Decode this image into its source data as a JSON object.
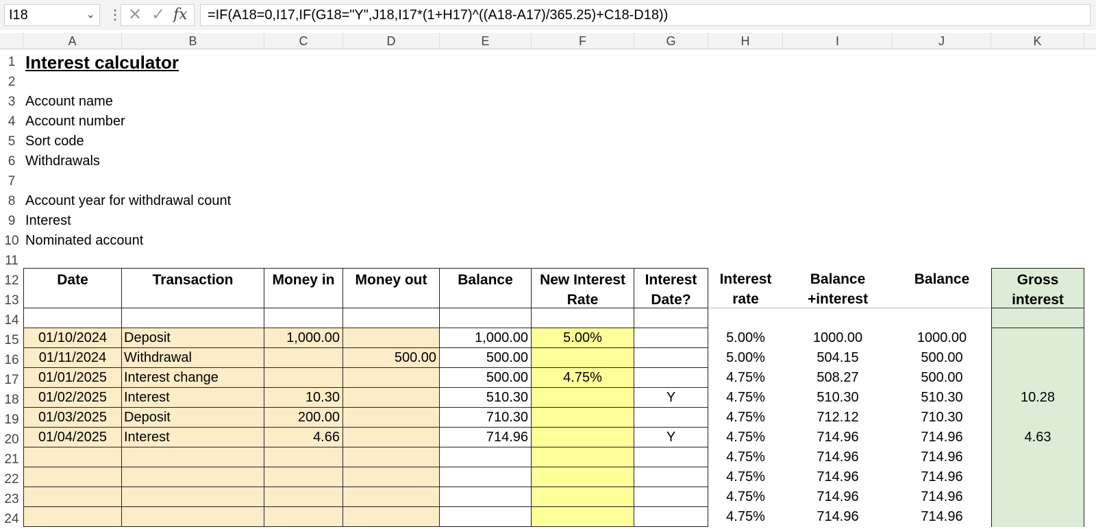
{
  "formula_bar": {
    "name_box": "I18",
    "formula": "=IF(A18=0,I17,IF(G18=\"Y\",J18,I17*(1+H17)^((A18-A17)/365.25)+C18-D18))"
  },
  "columns": [
    "A",
    "B",
    "C",
    "D",
    "E",
    "F",
    "G",
    "H",
    "I",
    "J",
    "K"
  ],
  "rows": [
    "1",
    "2",
    "3",
    "4",
    "5",
    "6",
    "7",
    "8",
    "9",
    "10",
    "11",
    "12",
    "13",
    "14",
    "15",
    "16",
    "17",
    "18",
    "19",
    "20",
    "21",
    "22",
    "23",
    "24"
  ],
  "sheet": {
    "title": "Interest calculator",
    "labels": {
      "account_name": "Account name",
      "account_number": "Account number",
      "sort_code": "Sort code",
      "withdrawals": "Withdrawals",
      "account_year": "Account year for withdrawal count",
      "interest": "Interest",
      "nominated_account": "Nominated account"
    },
    "headers": {
      "date": "Date",
      "transaction": "Transaction",
      "money_in": "Money in",
      "money_out": "Money out",
      "balance": "Balance",
      "new_rate_1": "New Interest",
      "new_rate_2": "Rate",
      "int_date_1": "Interest",
      "int_date_2": "Date?",
      "rate_1": "Interest",
      "rate_2": "rate",
      "bal_int_1": "Balance",
      "bal_int_2": "+interest",
      "balance2": "Balance",
      "gross_1": "Gross",
      "gross_2": "interest"
    },
    "data_rows": [
      {
        "date": "01/10/2024",
        "transaction": "Deposit",
        "money_in": "1,000.00",
        "money_out": "",
        "balance": "1,000.00",
        "new_rate": "5.00%",
        "int_date": "",
        "rate": "5.00%",
        "bal_int": "1000.00",
        "balance2": "1000.00",
        "gross": ""
      },
      {
        "date": "01/11/2024",
        "transaction": "Withdrawal",
        "money_in": "",
        "money_out": "500.00",
        "balance": "500.00",
        "new_rate": "",
        "int_date": "",
        "rate": "5.00%",
        "bal_int": "504.15",
        "balance2": "500.00",
        "gross": ""
      },
      {
        "date": "01/01/2025",
        "transaction": "Interest change",
        "money_in": "",
        "money_out": "",
        "balance": "500.00",
        "new_rate": "4.75%",
        "int_date": "",
        "rate": "4.75%",
        "bal_int": "508.27",
        "balance2": "500.00",
        "gross": ""
      },
      {
        "date": "01/02/2025",
        "transaction": "Interest",
        "money_in": "10.30",
        "money_out": "",
        "balance": "510.30",
        "new_rate": "",
        "int_date": "Y",
        "rate": "4.75%",
        "bal_int": "510.30",
        "balance2": "510.30",
        "gross": "10.28"
      },
      {
        "date": "01/03/2025",
        "transaction": "Deposit",
        "money_in": "200.00",
        "money_out": "",
        "balance": "710.30",
        "new_rate": "",
        "int_date": "",
        "rate": "4.75%",
        "bal_int": "712.12",
        "balance2": "710.30",
        "gross": ""
      },
      {
        "date": "01/04/2025",
        "transaction": "Interest",
        "money_in": "4.66",
        "money_out": "",
        "balance": "714.96",
        "new_rate": "",
        "int_date": "Y",
        "rate": "4.75%",
        "bal_int": "714.96",
        "balance2": "714.96",
        "gross": "4.63"
      },
      {
        "date": "",
        "transaction": "",
        "money_in": "",
        "money_out": "",
        "balance": "",
        "new_rate": "",
        "int_date": "",
        "rate": "4.75%",
        "bal_int": "714.96",
        "balance2": "714.96",
        "gross": ""
      },
      {
        "date": "",
        "transaction": "",
        "money_in": "",
        "money_out": "",
        "balance": "",
        "new_rate": "",
        "int_date": "",
        "rate": "4.75%",
        "bal_int": "714.96",
        "balance2": "714.96",
        "gross": ""
      },
      {
        "date": "",
        "transaction": "",
        "money_in": "",
        "money_out": "",
        "balance": "",
        "new_rate": "",
        "int_date": "",
        "rate": "4.75%",
        "bal_int": "714.96",
        "balance2": "714.96",
        "gross": ""
      },
      {
        "date": "",
        "transaction": "",
        "money_in": "",
        "money_out": "",
        "balance": "",
        "new_rate": "",
        "int_date": "",
        "rate": "4.75%",
        "bal_int": "714.96",
        "balance2": "714.96",
        "gross": ""
      }
    ]
  }
}
